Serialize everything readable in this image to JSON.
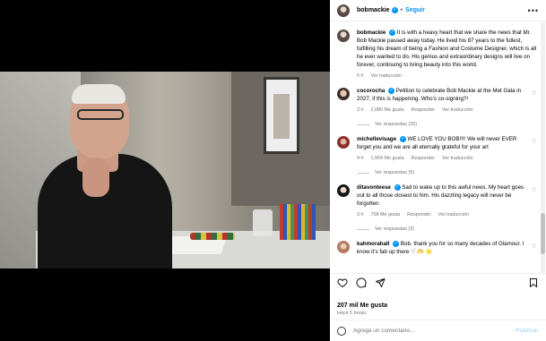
{
  "post": {
    "username": "bobmackie",
    "follow_label": "Seguir",
    "caption": "It is with a heavy heart that we share the news that Mr. Bob Mackie passed away today. He lived his 87 years to the fullest, fulfilling his dream of being a Fashion and Costume Designer, which is all he ever wanted to do. His genius and extraordinary designs will live on forever, continuing to bring beauty into this world.",
    "caption_time": "5 h",
    "caption_translate": "Ver traducción",
    "likes": "207 mil Me gusta",
    "posted_ago": "Hace 5 horas"
  },
  "comments": [
    {
      "username": "cocorocha",
      "text": "Petition to celebrate Bob Mackie at the Met Gala in 2027, if this is happening. Who’s co-signing?!",
      "time": "3 h",
      "likes": "2,080 Me gusta",
      "reply": "Responder",
      "translate": "Ver traducción",
      "replies": "Ver respuestas (26)"
    },
    {
      "username": "michellevisage",
      "text": "WE LOVE YOU BOB!!!! We will never EVER forget you and we are all eternally grateful for your art",
      "time": "4 h",
      "likes": "1,904 Me gusta",
      "reply": "Responder",
      "translate": "Ver traducción",
      "replies": "Ver respuestas (5)"
    },
    {
      "username": "ditavonteese",
      "text": "Sad to wake up to this awful news. My heart goes out to all those closest to him. His dazzling legacy will never be forgotten.",
      "time": "3 h",
      "likes": "708 Me gusta",
      "reply": "Responder",
      "translate": "Ver traducción",
      "replies": "Ver respuestas (3)"
    },
    {
      "username": "kahmorahall",
      "text": "Bob. thank you for so many decades of Glamour. I know it’s fab up there ♡ 🫶 🌟"
    }
  ],
  "compose": {
    "placeholder": "Agrega un comentario...",
    "publish_label": "Publicar"
  },
  "icons": {
    "more": "more-options-icon",
    "like": "heart-icon",
    "comment": "comment-icon",
    "share": "share-icon",
    "save": "bookmark-icon",
    "emoji": "emoji-icon"
  },
  "colors": {
    "accent": "#0095f6",
    "muted": "#737373"
  }
}
